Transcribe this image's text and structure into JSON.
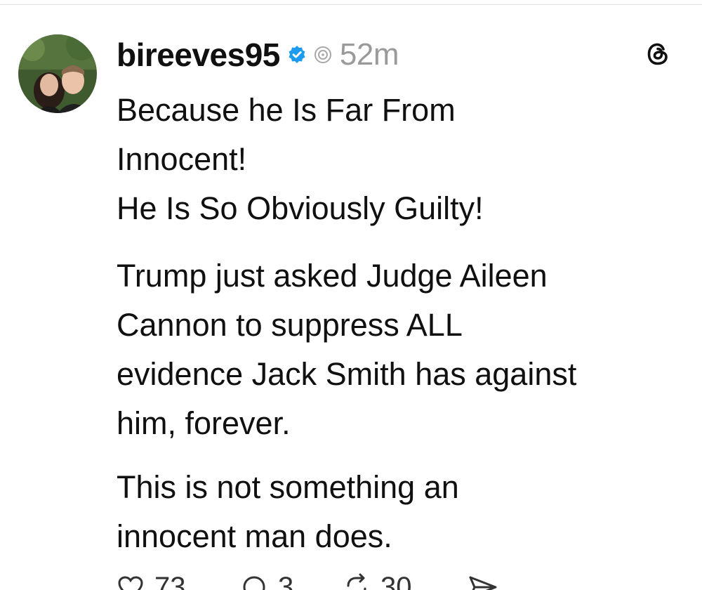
{
  "post": {
    "username": "bireeves95",
    "verified_color": "#1d9bf0",
    "time": "52m",
    "paragraphs": [
      [
        "Because he Is Far From",
        "Innocent!",
        "He Is So Obviously Guilty!"
      ],
      [
        "Trump just asked Judge Aileen",
        "Cannon to suppress ALL",
        "evidence Jack Smith has against",
        "him, forever."
      ],
      [
        "This is not something an",
        "innocent man does."
      ]
    ],
    "actions": {
      "likes": "73",
      "replies": "3",
      "reposts": "30"
    }
  },
  "icons": {
    "avatar": "avatar-photo",
    "verified": "verified-badge-icon",
    "activity": "activity-status-icon",
    "app_logo": "threads-logo-icon",
    "like": "heart-icon",
    "reply": "comment-icon",
    "repost": "repost-icon",
    "share": "send-icon"
  }
}
